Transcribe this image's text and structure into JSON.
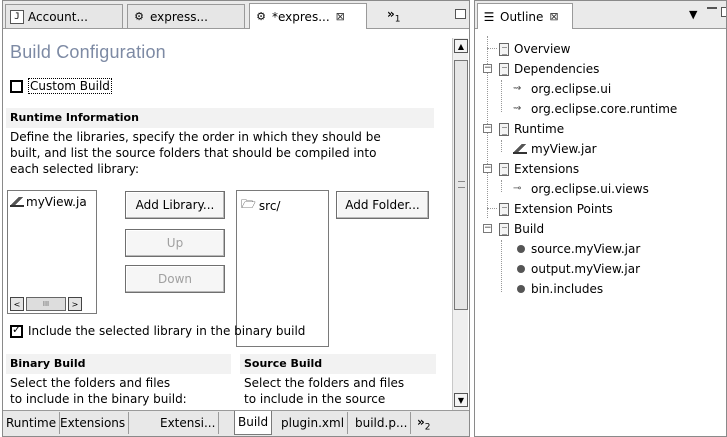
{
  "editor": {
    "tabs": [
      {
        "label": "Account...",
        "icon": "doc-icon"
      },
      {
        "label": "express...",
        "icon": "plugin-manifest-icon"
      },
      {
        "label": "*expres...",
        "icon": "plugin-manifest-icon",
        "close": "⊠"
      },
      {
        "label": "»1"
      }
    ],
    "overflow_chevron": "»",
    "overflow_count": "1",
    "page_title": "Build Configuration",
    "custom_build_label": "Custom Build",
    "runtime_section": {
      "header": "Runtime Information",
      "description_lines": [
        "Define the libraries, specify the order in which they should be",
        "built, and list the source folders that should be compiled into",
        "each selected library:"
      ],
      "library_item": "myView.ja",
      "buttons": {
        "add_library": "Add Library...",
        "up": "Up",
        "down": "Down",
        "add_folder": "Add Folder..."
      },
      "scroll_left": "<",
      "scroll_thumb": "III",
      "scroll_right": ">",
      "source_folder": "src/",
      "include_label": "Include the selected library in the binary build"
    },
    "binary_section": {
      "header": "Binary Build",
      "description_lines": [
        "Select the folders and files",
        "to include in the binary build:"
      ]
    },
    "source_section": {
      "header": "Source Build",
      "description_lines": [
        "Select the folders and files",
        "to include in the source"
      ]
    },
    "bottom_tabs": [
      {
        "label": "Runtime"
      },
      {
        "label": "Extensions"
      },
      {
        "label": "Extensi..."
      },
      {
        "label": "Build",
        "active": true
      },
      {
        "label": "plugin.xml"
      },
      {
        "label": "build.p..."
      }
    ],
    "bottom_overflow_chevron": "»",
    "bottom_overflow_count": "2"
  },
  "outline": {
    "title": "Outline",
    "close": "⊠",
    "tree": [
      {
        "label": "Overview",
        "icon": "page-icon",
        "level": 0
      },
      {
        "label": "Dependencies",
        "icon": "page-icon",
        "level": 0,
        "expander": "−"
      },
      {
        "label": "org.eclipse.ui",
        "icon": "plugin-icon",
        "level": 1
      },
      {
        "label": "org.eclipse.core.runtime",
        "icon": "plugin-icon",
        "level": 1
      },
      {
        "label": "Runtime",
        "icon": "page-icon",
        "level": 0,
        "expander": "−"
      },
      {
        "label": "myView.jar",
        "icon": "jar-icon",
        "level": 1,
        "selected": true
      },
      {
        "label": "Extensions",
        "icon": "page-icon",
        "level": 0,
        "expander": "−"
      },
      {
        "label": "org.eclipse.ui.views",
        "icon": "extension-icon",
        "level": 1
      },
      {
        "label": "Extension Points",
        "icon": "page-icon",
        "level": 0
      },
      {
        "label": "Build",
        "icon": "page-icon",
        "level": 0,
        "expander": "−"
      },
      {
        "label": "source.myView.jar",
        "icon": "bullet-icon",
        "level": 1
      },
      {
        "label": "output.myView.jar",
        "icon": "bullet-icon",
        "level": 1
      },
      {
        "label": "bin.includes",
        "icon": "bullet-icon",
        "level": 1
      }
    ]
  },
  "colors": {
    "title_blue": "#7d8aa4",
    "section_bg": "#f2f2f2",
    "tab_bg": "#eaeaea"
  }
}
